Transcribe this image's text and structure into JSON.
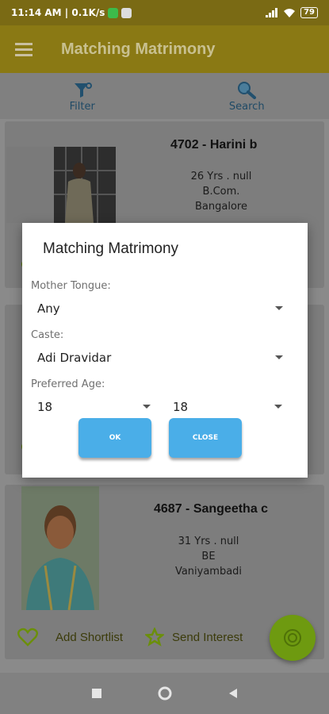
{
  "status_bar": {
    "time_speed": "11:14 AM | 0.1K/s",
    "battery": "79"
  },
  "app_bar": {
    "title": "Matching Matrimony",
    "menu_icon": "hamburger-menu-icon"
  },
  "toolbar": {
    "filter_label": "Filter",
    "search_label": "Search"
  },
  "profiles": [
    {
      "name": "4702 - Harini b",
      "age": "26 Yrs . null",
      "education": "B.Com.",
      "location": "Bangalore"
    },
    {
      "name": "4687 - Sangeetha c",
      "age": "31 Yrs . null",
      "education": "BE",
      "location": "Vaniyambadi"
    }
  ],
  "card_actions": {
    "shortlist_label": "Add Shortlist",
    "interest_label": "Send Interest"
  },
  "dialog": {
    "title": "Matching Matrimony",
    "mother_tongue_label": "Mother Tongue:",
    "mother_tongue_value": "Any",
    "caste_label": "Caste:",
    "caste_value": "Adi Dravidar",
    "preferred_age_label": "Preferred Age:",
    "age_from_value": "18",
    "age_to_value": "18",
    "ok_label": "OK",
    "close_label": "CLOSE"
  },
  "colors": {
    "app_bar": "#8a7914",
    "accent_button": "#4aaee8",
    "fab": "#6e9a10",
    "icon_green": "#6b8f0a"
  }
}
